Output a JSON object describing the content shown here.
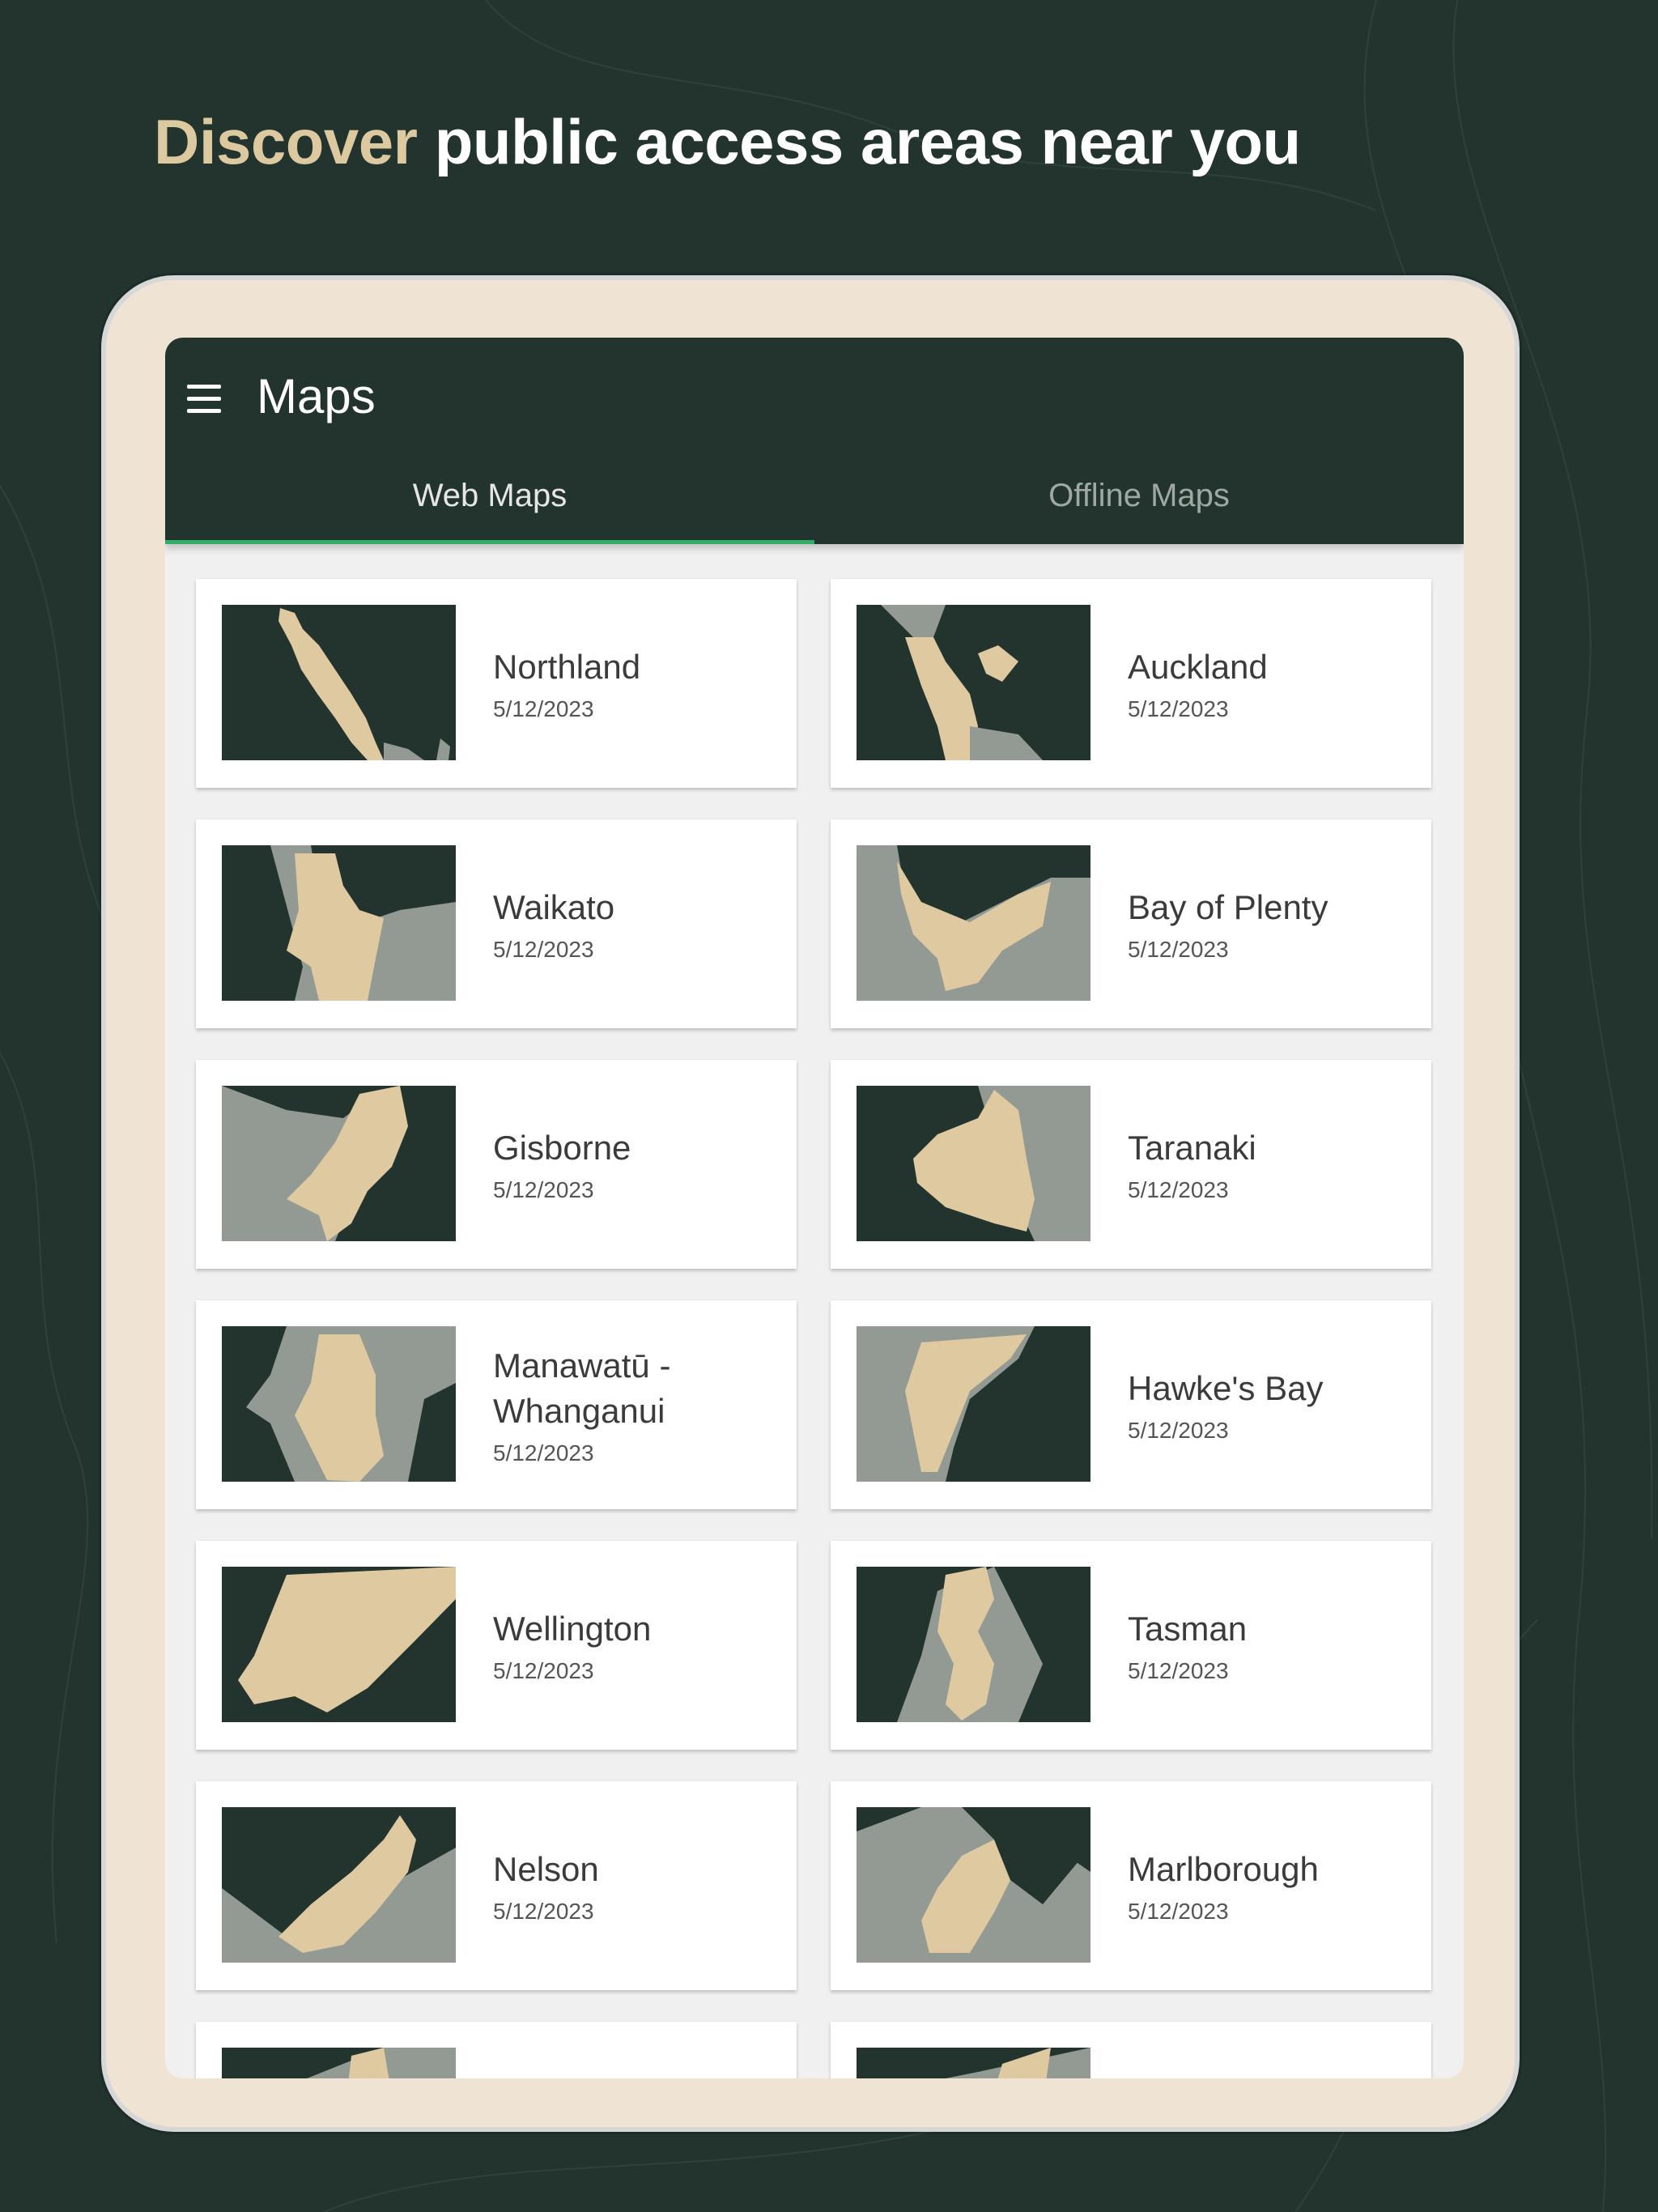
{
  "headline": {
    "accent": "Discover",
    "rest": " public access areas near you"
  },
  "appbar": {
    "title": "Maps",
    "menu_icon": "hamburger-menu-icon"
  },
  "tabs": [
    {
      "label": "Web Maps",
      "active": true
    },
    {
      "label": "Offline Maps",
      "active": false
    }
  ],
  "colors": {
    "background": "#22342d",
    "accent_text": "#dcc9a0",
    "tablet_frame": "#efe4d3",
    "tab_indicator": "#2fae67",
    "map_land_highlight": "#dfc9a0",
    "map_land_other": "#939a94",
    "map_water": "#22342d"
  },
  "maps": [
    {
      "name": "Northland",
      "date": "5/12/2023"
    },
    {
      "name": "Auckland",
      "date": "5/12/2023"
    },
    {
      "name": "Waikato",
      "date": "5/12/2023"
    },
    {
      "name": "Bay of Plenty",
      "date": "5/12/2023"
    },
    {
      "name": "Gisborne",
      "date": "5/12/2023"
    },
    {
      "name": "Taranaki",
      "date": "5/12/2023"
    },
    {
      "name": "Manawatū - Whanganui",
      "date": "5/12/2023"
    },
    {
      "name": "Hawke's Bay",
      "date": "5/12/2023"
    },
    {
      "name": "Wellington",
      "date": "5/12/2023"
    },
    {
      "name": "Tasman",
      "date": "5/12/2023"
    },
    {
      "name": "Nelson",
      "date": "5/12/2023"
    },
    {
      "name": "Marlborough",
      "date": "5/12/2023"
    },
    {
      "name": "",
      "date": ""
    },
    {
      "name": "",
      "date": ""
    }
  ]
}
